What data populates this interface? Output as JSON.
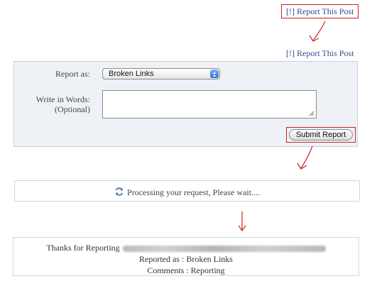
{
  "report_link": {
    "top_label": "[!] Report This Post",
    "mid_label": "[!] Report This Post"
  },
  "form": {
    "report_as_label": "Report as:",
    "report_as_value": "Broken Links",
    "words_label": "Write in Words:",
    "words_optional": "(Optional)",
    "words_value": "",
    "submit_label": "Submit Report"
  },
  "processing": {
    "message": "Processing your request, Please wait...."
  },
  "thanks": {
    "thanks_label": "Thanks for Reporting",
    "reported_as": "Reported as : Broken Links",
    "comments": "Comments : Reporting"
  },
  "colors": {
    "link": "#2f4d86",
    "annotation": "#cc2222",
    "form_bg": "#eef2f6",
    "box_border": "#cfd6dd"
  },
  "icons": {
    "arrow_icon": "hand-drawn-arrow-icon",
    "spinner_icon": "refresh-spinner-icon",
    "dropdown_icon": "chevron-updown-icon"
  }
}
